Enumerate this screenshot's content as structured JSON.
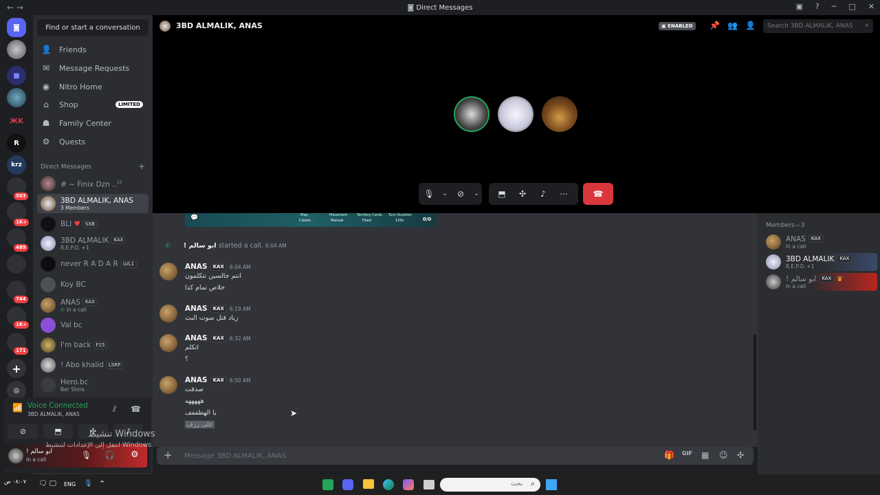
{
  "window": {
    "title": "Direct Messages",
    "nav": "← →"
  },
  "sidebar": {
    "find_placeholder": "Find or start a conversation",
    "nav": [
      {
        "label": "Friends",
        "icon": "friends-icon"
      },
      {
        "label": "Message Requests",
        "icon": "mail-icon"
      },
      {
        "label": "Nitro Home",
        "icon": "nitro-icon"
      },
      {
        "label": "Shop",
        "icon": "shop-icon",
        "badge": "LIMITED"
      },
      {
        "label": "Family Center",
        "icon": "family-icon"
      },
      {
        "label": "Quests",
        "icon": "quests-icon"
      }
    ],
    "dm_header": "Direct Messages",
    "dm_add": "+",
    "dms": [
      {
        "name": "# ~ Finix Dzn ..",
        "sup": "13",
        "sub": "",
        "tag": ""
      },
      {
        "name": "3BD ALMALIK, ANAS",
        "sub": "3 Members",
        "tag": ""
      },
      {
        "name": "BLI",
        "sub": "",
        "tag": "SXB"
      },
      {
        "name": "3BD ALMALIK",
        "sub": "R.E.P.O. +1",
        "tag": "KAX"
      },
      {
        "name": "never R A D A R",
        "sub": "",
        "tag": "LVL1"
      },
      {
        "name": "Koy BC",
        "sub": "",
        "tag": ""
      },
      {
        "name": "ANAS",
        "sub": "In a call",
        "tag": "KAX"
      },
      {
        "name": "Val bc",
        "sub": "",
        "tag": ""
      },
      {
        "name": "I'm back",
        "sub": "",
        "tag": "F15"
      },
      {
        "name": "! Abo khalid",
        "sub": "",
        "tag": "LSRP"
      },
      {
        "name": "Hero.bc",
        "sub": "Ber Store",
        "tag": ""
      }
    ],
    "voice": {
      "status": "Voice Connected",
      "channel": "3BD ALMALIK, ANAS"
    },
    "user": {
      "name": "! ابو سالم",
      "status": "In a call"
    }
  },
  "rail": {
    "badges": [
      "503",
      "1K+",
      "489",
      "744",
      "1K+",
      "171"
    ],
    "letters": [
      "R",
      "krz"
    ]
  },
  "header": {
    "title": "3BD ALMALIK, ANAS",
    "enabled_label": "ENABLED",
    "search_placeholder": "Search 3BD ALMALIK, ANAS"
  },
  "call": {
    "mini_labels": [
      "Map",
      "Classic",
      "Placement",
      "Manual",
      "Territory Cards",
      "Fixed",
      "Turn Duration",
      "120s"
    ],
    "score": "0/0"
  },
  "chat": {
    "system": {
      "author": "! ابو سالم",
      "text": "started a call.",
      "time": "6:04 AM"
    },
    "messages": [
      {
        "author": "ANAS",
        "tag": "KAX",
        "time": "6:04 AM",
        "lines": [
          "انتم جالسين تتكلمون",
          "خلاص تمام كذا"
        ]
      },
      {
        "author": "ANAS",
        "tag": "KAX",
        "time": "6:19 AM",
        "lines": [
          "زياد قتل سوت البث"
        ]
      },
      {
        "author": "ANAS",
        "tag": "KAX",
        "time": "6:32 AM",
        "lines": [
          "اتكلم",
          "؟"
        ]
      },
      {
        "author": "ANAS",
        "tag": "KAX",
        "time": "6:50 AM",
        "lines": [
          "صدقت",
          "هههههه",
          "يا الهطففف",
          "على زرف"
        ]
      }
    ],
    "input_placeholder": "Message 3BD ALMALIK, ANAS"
  },
  "members": {
    "header": "Members—3",
    "list": [
      {
        "name": "ANAS",
        "tag": "KAX",
        "status": "In a call"
      },
      {
        "name": "3BD ALMALIK",
        "tag": "KAX",
        "status": "R.E.P.O. +1"
      },
      {
        "name": "! ابو سالم",
        "tag": "KAX",
        "status": "In a call"
      }
    ]
  },
  "overlay": {
    "activation_title": "تنشيط Windows",
    "activation_sub": "انتقل إلى الإعدادات لتنشيط Windows"
  },
  "taskbar": {
    "lang": "ENG",
    "time": "٠٨:٠٧ ص",
    "search_placeholder": "بحث"
  },
  "colors": {
    "accent": "#5865f2",
    "online": "#23a55a",
    "danger": "#da373c"
  }
}
